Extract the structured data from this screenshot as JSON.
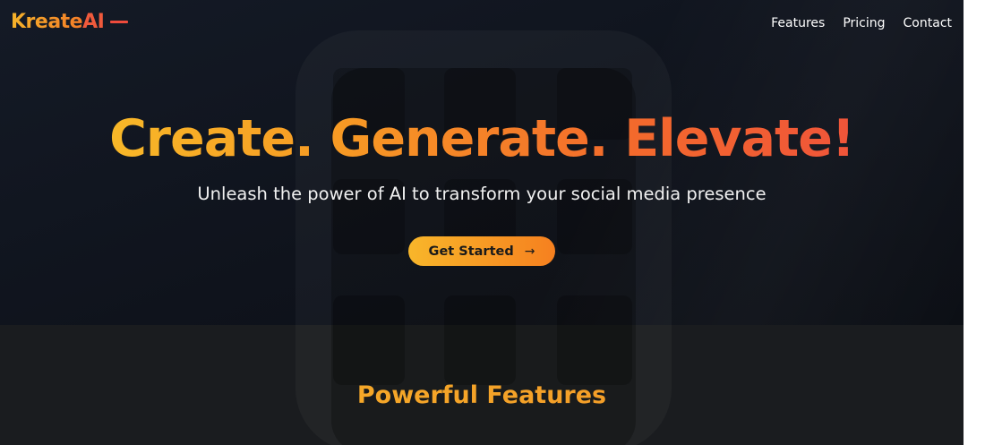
{
  "brand": {
    "name_part1": "Kreate",
    "name_part2": "AI"
  },
  "nav": {
    "items": [
      {
        "label": "Features"
      },
      {
        "label": "Pricing"
      },
      {
        "label": "Contact"
      }
    ]
  },
  "hero": {
    "headline": "Create. Generate. Elevate!",
    "subheadline": "Unleash the power of AI to transform your social media presence",
    "cta_label": "Get Started",
    "cta_icon": "arrow-right-icon"
  },
  "features": {
    "title": "Powerful Features"
  },
  "colors": {
    "accent_yellow": "#f8c62a",
    "accent_orange": "#f6801f",
    "accent_red": "#ee4a40",
    "background": "#111419"
  }
}
